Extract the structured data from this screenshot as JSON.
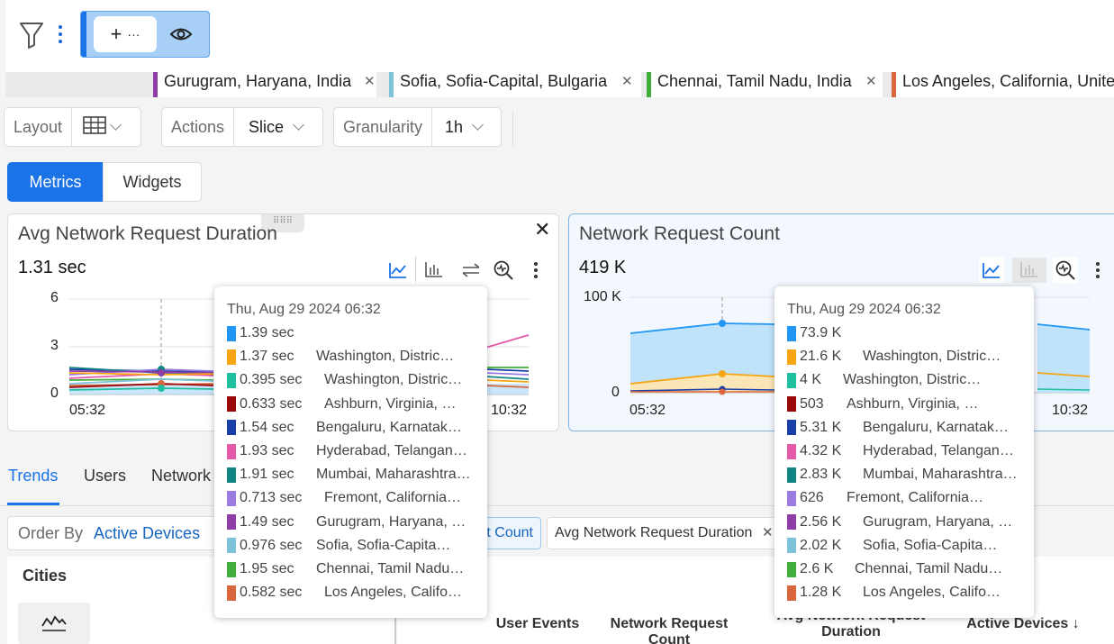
{
  "filters": [
    {
      "label": "Gurugram, Haryana, India",
      "color": "#8e3ea6"
    },
    {
      "label": "Sofia, Sofia-Capital, Bulgaria",
      "color": "#7cc2d9"
    },
    {
      "label": "Chennai, Tamil Nadu, India",
      "color": "#3fae3b"
    },
    {
      "label": "Los Angeles, California, United States",
      "color": "#d9663d"
    }
  ],
  "controls": {
    "layout_label": "Layout",
    "actions_label": "Actions",
    "actions_value": "Slice",
    "granularity_label": "Granularity",
    "granularity_value": "1h"
  },
  "view_toggle": {
    "metrics": "Metrics",
    "widgets": "Widgets",
    "active": "metrics"
  },
  "series_colors": [
    "#2196f3",
    "#f7a513",
    "#1fbfa0",
    "#9b0a0a",
    "#1a3ea8",
    "#e55aa8",
    "#138484",
    "#9b7be0",
    "#8e3ea6",
    "#7cc2d9",
    "#3fae3b",
    "#d9663d"
  ],
  "cards": [
    {
      "title": "Avg Network Request Duration",
      "value": "1.31 sec",
      "y_ticks": [
        "6",
        "3",
        "0"
      ],
      "x_ticks": [
        "05:32",
        "10:32"
      ]
    },
    {
      "title": "Network Request Count",
      "value": "419 K",
      "y_ticks": [
        "100 K",
        "0"
      ],
      "x_ticks": [
        "05:32",
        "10:32"
      ]
    }
  ],
  "tooltip1": {
    "time": "Thu, Aug 29 2024 06:32",
    "rows": [
      {
        "value": "1.39 sec",
        "name": ""
      },
      {
        "value": "1.37 sec",
        "name": "Washington, Distric…"
      },
      {
        "value": "0.395 sec",
        "name": "Washington, Distric…"
      },
      {
        "value": "0.633 sec",
        "name": "Ashburn, Virginia, …"
      },
      {
        "value": "1.54 sec",
        "name": "Bengaluru, Karnatak…"
      },
      {
        "value": "1.93 sec",
        "name": "Hyderabad, Telangan…"
      },
      {
        "value": "1.91 sec",
        "name": "Mumbai, Maharashtra…"
      },
      {
        "value": "0.713 sec",
        "name": "Fremont, California…"
      },
      {
        "value": "1.49 sec",
        "name": "Gurugram, Haryana, …"
      },
      {
        "value": "0.976 sec",
        "name": "Sofia, Sofia-Capita…"
      },
      {
        "value": "1.95 sec",
        "name": "Chennai, Tamil Nadu…"
      },
      {
        "value": "0.582 sec",
        "name": "Los Angeles, Califo…"
      }
    ]
  },
  "tooltip2": {
    "time": "Thu, Aug 29 2024 06:32",
    "rows": [
      {
        "value": "73.9 K",
        "name": ""
      },
      {
        "value": "21.6 K",
        "name": "Washington, Distric…"
      },
      {
        "value": "4 K",
        "name": "Washington, Distric…"
      },
      {
        "value": "503",
        "name": "Ashburn, Virginia, …"
      },
      {
        "value": "5.31 K",
        "name": "Bengaluru, Karnatak…"
      },
      {
        "value": "4.32 K",
        "name": "Hyderabad, Telangan…"
      },
      {
        "value": "2.83 K",
        "name": "Mumbai, Maharashtra…"
      },
      {
        "value": "626",
        "name": "Fremont, California…"
      },
      {
        "value": "2.56 K",
        "name": "Gurugram, Haryana, …"
      },
      {
        "value": "2.02 K",
        "name": "Sofia, Sofia-Capita…"
      },
      {
        "value": "2.6 K",
        "name": "Chennai, Tamil Nadu…"
      },
      {
        "value": "1.28 K",
        "name": "Los Angeles, Califo…"
      }
    ]
  },
  "tabs": [
    "Trends",
    "Users",
    "Network"
  ],
  "order_by": {
    "label": "Order By",
    "value": "Active Devices"
  },
  "metric_chips": [
    "t Count",
    "Avg Network Request Duration"
  ],
  "cities_label": "Cities",
  "table_headers": [
    "User Events",
    "Network Request Count",
    "Avg Network Request Duration",
    "Active Devices ↓"
  ]
}
